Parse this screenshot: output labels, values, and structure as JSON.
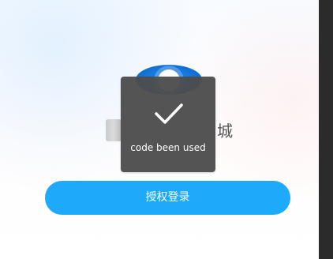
{
  "title": {
    "right_fragment": "城"
  },
  "toast": {
    "message": "code been used",
    "icon": "checkmark-icon"
  },
  "auth_button": {
    "label": "授权登录"
  },
  "colors": {
    "primary_button": "#1eaafa",
    "toast_background": "#4d4d4d",
    "right_edge": "#2b2b2b",
    "logo_blue": "#1475d8"
  }
}
